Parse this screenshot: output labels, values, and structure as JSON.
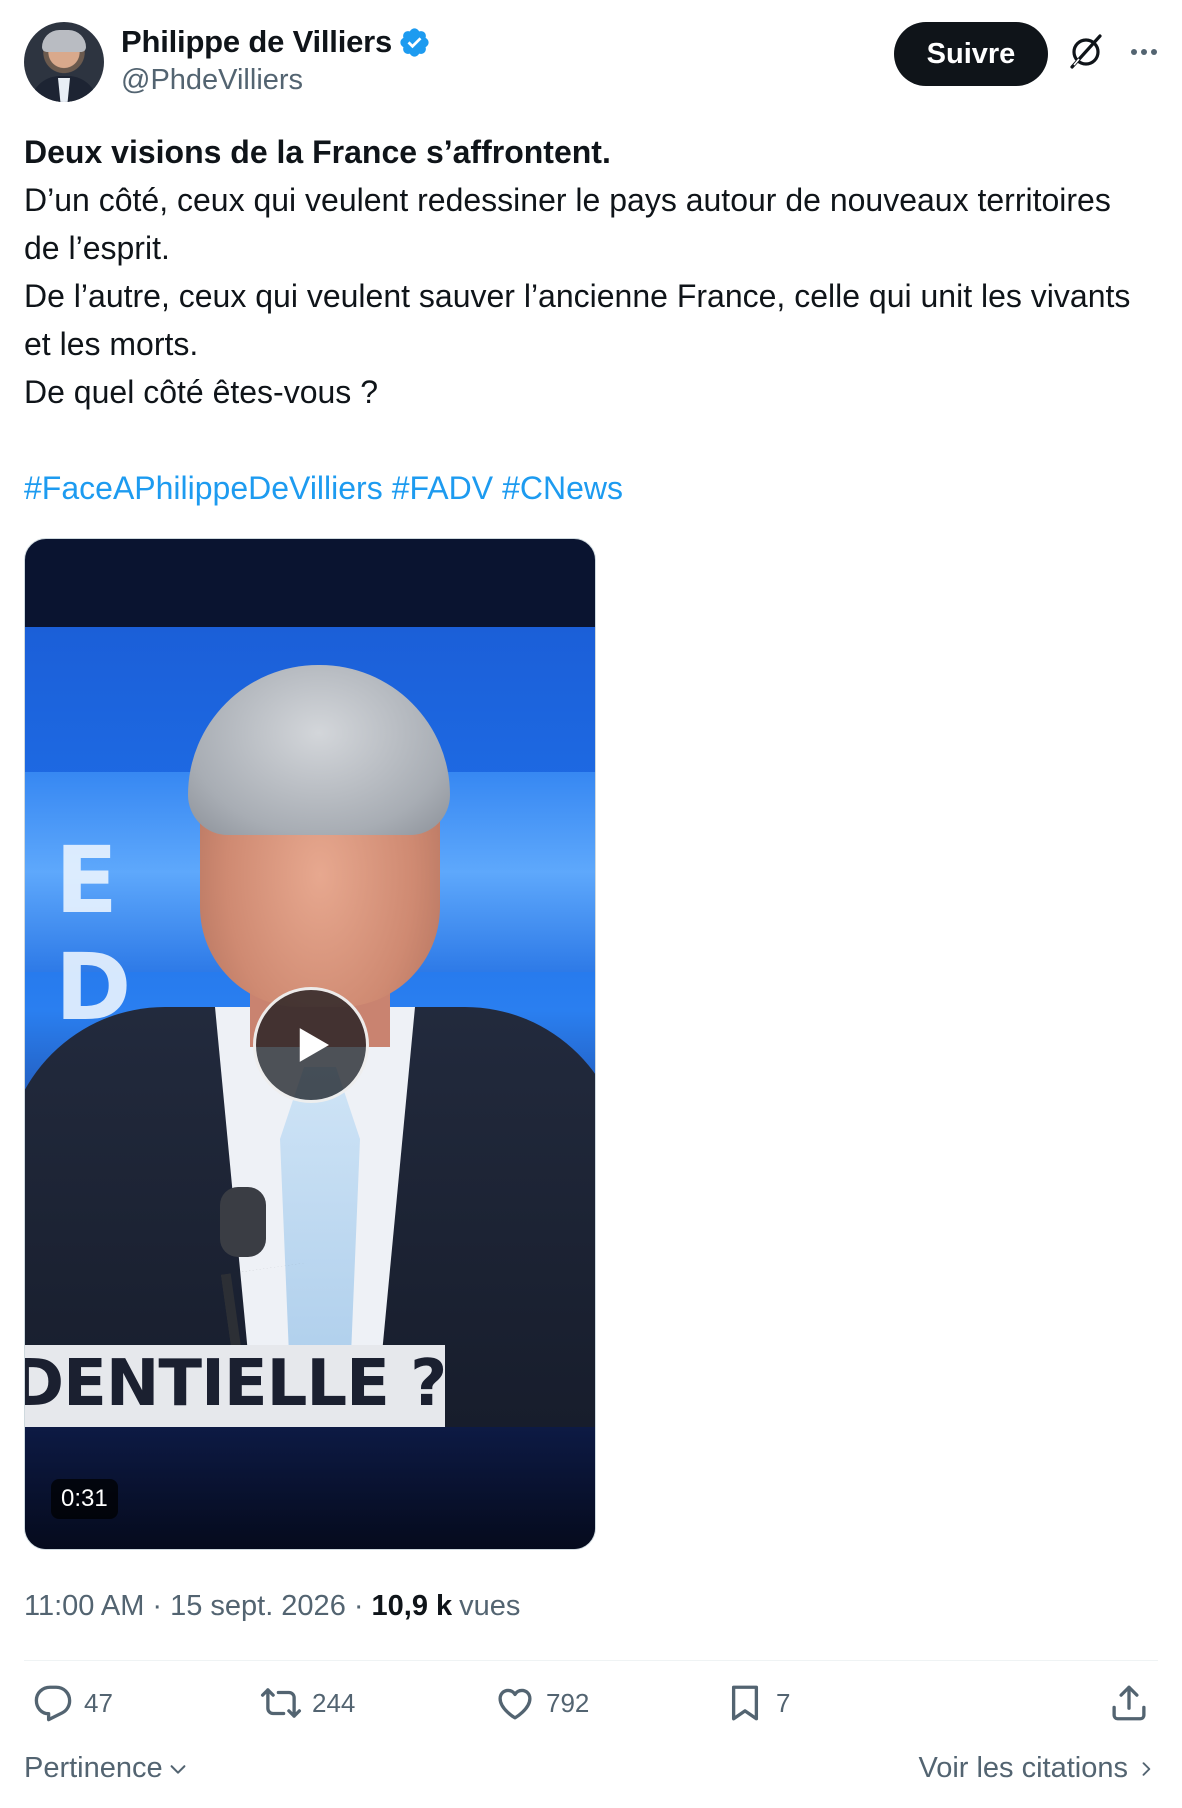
{
  "author": {
    "name": "Philippe de Villiers",
    "handle": "@PhdeVilliers",
    "verified": true,
    "verified_color": "#1d9bf0"
  },
  "header": {
    "follow_label": "Suivre",
    "grok_icon": "grok-icon",
    "more_icon": "more-icon"
  },
  "tweet": {
    "headline": "Deux visions de la France s’affrontent.",
    "lines": [
      "D’un côté, ceux qui veulent redessiner le pays autour de nouveaux territoires de l’esprit.",
      "De l’autre, ceux qui veulent sauver l’ancienne France, celle qui unit les vivants et les morts.",
      "De quel côté êtes-vous ?"
    ],
    "hashtags": [
      "#FaceAPhilippeDeVilliers",
      "#FADV",
      "#CNews"
    ],
    "hashtag_color": "#1d9bf0"
  },
  "media": {
    "type": "video",
    "duration": "0:31",
    "lower_third": "DENTIELLE ?",
    "studio_letters": "E D"
  },
  "meta": {
    "time": "11:00 AM",
    "date": "15 sept. 2026",
    "views_count": "10,9 k",
    "views_label": "vues"
  },
  "actions": {
    "replies": "47",
    "reposts": "244",
    "likes": "792",
    "bookmarks": "7"
  },
  "footer": {
    "sort_label": "Pertinence",
    "quotes_label": "Voir les citations"
  }
}
